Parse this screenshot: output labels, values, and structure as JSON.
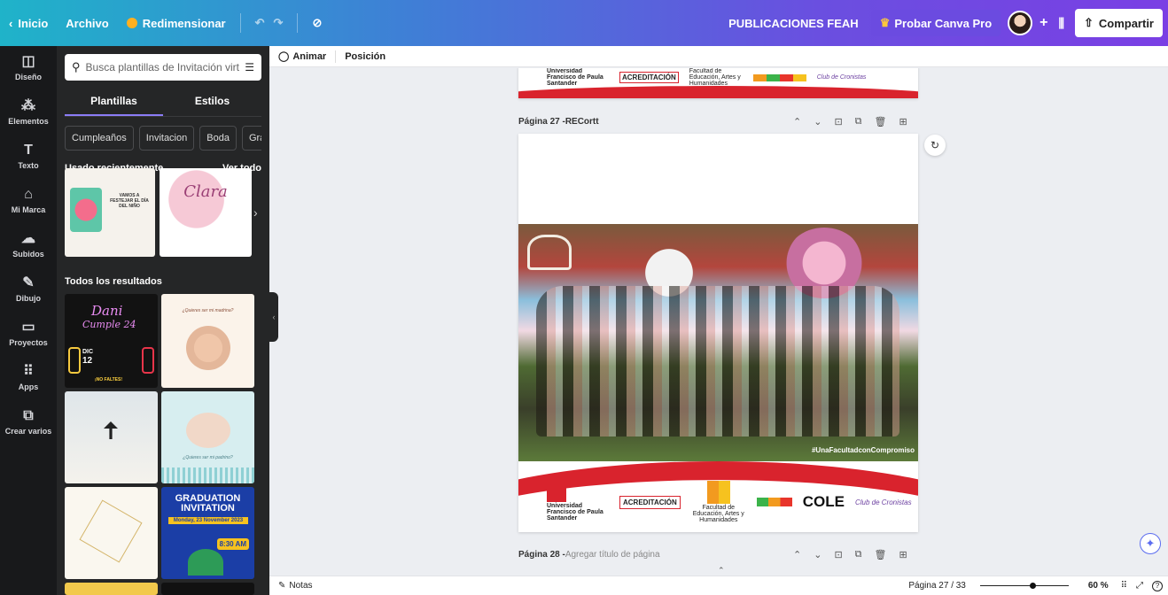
{
  "topbar": {
    "back": "Inicio",
    "file": "Archivo",
    "resize": "Redimensionar",
    "project_title": "PUBLICACIONES FEAH",
    "pro": "Probar Canva Pro",
    "share": "Compartir"
  },
  "rail": [
    {
      "label": "Diseño",
      "icon": "design-icon"
    },
    {
      "label": "Elementos",
      "icon": "elements-icon"
    },
    {
      "label": "Texto",
      "icon": "text-icon"
    },
    {
      "label": "Mi Marca",
      "icon": "brand-icon"
    },
    {
      "label": "Subidos",
      "icon": "upload-icon"
    },
    {
      "label": "Dibujo",
      "icon": "draw-icon"
    },
    {
      "label": "Proyectos",
      "icon": "folder-icon"
    },
    {
      "label": "Apps",
      "icon": "apps-icon"
    },
    {
      "label": "Crear varios",
      "icon": "create-multiple-icon"
    }
  ],
  "panel": {
    "search_placeholder": "Busca plantillas de Invitación virtu",
    "tabs": [
      "Plantillas",
      "Estilos"
    ],
    "chips": [
      "Cumpleaños",
      "Invitacion",
      "Boda",
      "Grad"
    ],
    "recent_title": "Usado recientemente",
    "see_all": "Ver todo",
    "all_results_title": "Todos los resultados",
    "thumbs": {
      "recent1_text": "VAMOS A FESTEJAR EL DÍA DEL NIÑO",
      "recent2_text": "Clara",
      "dani_name": "Dani",
      "dani_sub": "Cumple 24",
      "dani_date_month": "DIC",
      "dani_date_day": "12",
      "dani_btn": "¡NO FALTES!",
      "baby1_text": "¿Quieres ser mi madrina?",
      "baby2_text": "¿Quieres ser mi padrino?",
      "grad_title": "GRADUATION INVITATION",
      "grad_date": "Monday, 23 November 2023",
      "grad_time": "8:30 AM"
    }
  },
  "subbar": {
    "animate": "Animar",
    "position": "Posición"
  },
  "pages": {
    "p27_label": "Página 27 - ",
    "p27_title": "RECortt",
    "p28_label": "Página 28 - ",
    "p28_placeholder": "Agregar título de página",
    "hashtag": "#UnaFacultadconCompromiso",
    "logo_univ": "Universidad Francisco de Paula Santander",
    "logo_acred": "ACREDITACIÓN",
    "logo_facultad": "Facultad de Educación, Artes y Humanidades",
    "logo_cole": "COLE",
    "logo_club": "Club de Cronistas"
  },
  "bottombar": {
    "notes": "Notas",
    "page_indicator": "Página 27 / 33",
    "zoom": "60 %",
    "zoom_fraction": 0.6
  }
}
